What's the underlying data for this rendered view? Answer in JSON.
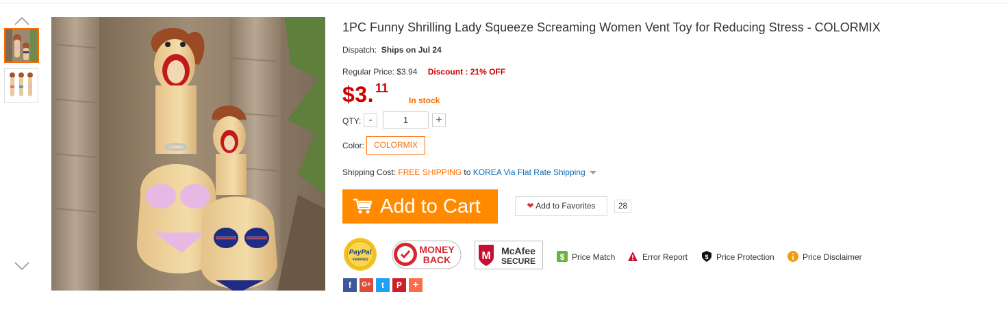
{
  "product": {
    "title": "1PC Funny Shrilling Lady Squeeze Screaming Women Vent Toy for Reducing Stress  -  COLORMIX",
    "dispatch_label": "Dispatch:",
    "dispatch_value": "Ships on Jul 24",
    "regular_price_label": "Regular Price:",
    "regular_price_value": "$3.94",
    "discount": "Discount : 21% OFF",
    "price_main": "$3.",
    "price_cents": "11",
    "stock_status": "In stock",
    "qty_label": "QTY:",
    "qty_minus": "-",
    "qty_value": "1",
    "qty_plus": "+",
    "color_label": "Color:",
    "color_option": "COLORMIX",
    "shipping_label": "Shipping Cost:",
    "shipping_free": "FREE SHIPPING",
    "shipping_to": "to",
    "shipping_method": "KOREA Via Flat Rate Shipping"
  },
  "actions": {
    "add_to_cart": "Add to Cart",
    "add_to_favorites": "Add to Favorites",
    "favorites_count": "28"
  },
  "badges": {
    "paypal_top": "PayPal",
    "paypal_bottom": "VERIFIED",
    "money_back_1": "MONEY",
    "money_back_2": "BACK",
    "mcafee_1": "McAfee",
    "mcafee_2": "SECURE"
  },
  "features": [
    {
      "label": "Price Match",
      "icon": "price-match-icon"
    },
    {
      "label": "Error Report",
      "icon": "warning-icon"
    },
    {
      "label": "Price Protection",
      "icon": "shield-icon"
    },
    {
      "label": "Price Disclaimer",
      "icon": "info-icon"
    }
  ],
  "share": [
    {
      "icon": "facebook-icon",
      "glyph": "f",
      "color": "#3b5998"
    },
    {
      "icon": "google-plus-icon",
      "glyph": "G+",
      "color": "#dd4b39"
    },
    {
      "icon": "twitter-icon",
      "glyph": "t",
      "color": "#1da1f2"
    },
    {
      "icon": "pinterest-icon",
      "glyph": "P",
      "color": "#cb2027"
    },
    {
      "icon": "more-share-icon",
      "glyph": "+",
      "color": "#fc6d4c"
    }
  ],
  "colors": {
    "accent": "#ff6a00",
    "price_red": "#cc0000",
    "cart_orange": "#ff8a00",
    "link_blue": "#0b6ab5"
  }
}
